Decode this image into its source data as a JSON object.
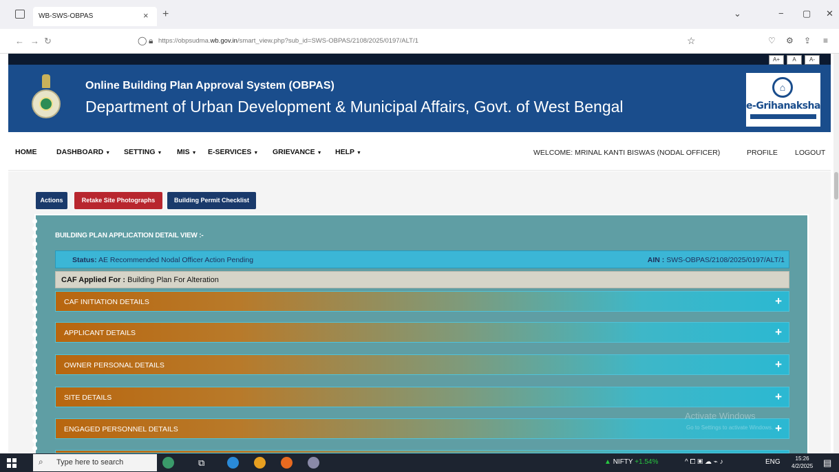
{
  "browser": {
    "tab_title": "WB-SWS-OBPAS",
    "tab_close": "×",
    "new_tab": "+",
    "window_controls": [
      "⌄",
      "−",
      "▢",
      "✕"
    ],
    "url_prefix": "https://obpsudma.",
    "url_domain": "wb.gov.in",
    "url_path": "/smart_view.php?sub_id=SWS-OBPAS/2108/2025/0197/ALT/1"
  },
  "font_size_buttons": [
    "A+",
    "A",
    "A-"
  ],
  "header": {
    "title": "Online Building Plan Approval System (OBPAS)",
    "subtitle": "Department of Urban Development & Municipal Affairs, Govt. of West Bengal",
    "logo_text": "e-Grihanaksha"
  },
  "nav": {
    "items": [
      "HOME",
      "DASHBOARD",
      "SETTING",
      "MIS",
      "E-SERVICES",
      "GRIEVANCE",
      "HELP"
    ],
    "welcome": "WELCOME: MRINAL KANTI BISWAS (NODAL OFFICER)",
    "profile": "PROFILE",
    "logout": "LOGOUT"
  },
  "actions": {
    "actions_label": "Actions",
    "retake_label": "Retake Site Photographs",
    "checklist_label": "Building Permit Checklist"
  },
  "panel": {
    "title": "BUILDING PLAN APPLICATION DETAIL VIEW :-",
    "status_label": "Status:",
    "status_value": "AE Recommended Nodal Officer Action Pending",
    "ain_label": "AIN :",
    "ain_value": "SWS-OBPAS/2108/2025/0197/ALT/1",
    "caf_label": "CAF Applied For :",
    "caf_value": "Building Plan For Alteration",
    "sections": [
      "CAF INITIATION DETAILS",
      "APPLICANT DETAILS",
      "OWNER PERSONAL DETAILS",
      "SITE DETAILS",
      "ENGAGED PERSONNEL DETAILS"
    ],
    "expand_symbol": "+"
  },
  "watermark": {
    "line1": "Activate Windows",
    "line2": "Go to Settings to activate Windows."
  },
  "taskbar": {
    "search_placeholder": "Type here to search",
    "nifty_label": "NIFTY",
    "nifty_change": "+1.54%",
    "lang": "ENG",
    "time": "15:26",
    "date": "4/2/2025"
  },
  "colors": {
    "banner": "#1a4d8c",
    "actions_btn": "#1a3a6b",
    "retake_btn": "#b8262e",
    "checklist_btn": "#1a3a6b",
    "panel_bg": "#5f9ea4",
    "status_bar": "#3bb6d6"
  }
}
